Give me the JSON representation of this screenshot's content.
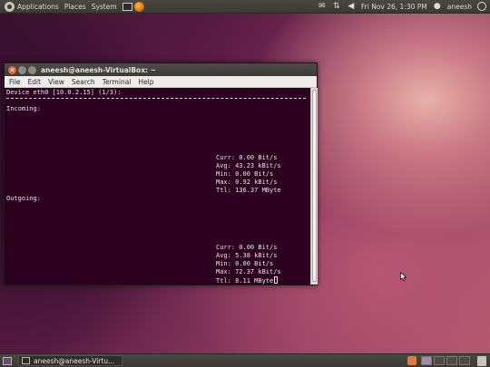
{
  "top_panel": {
    "menus": [
      "Applications",
      "Places",
      "System"
    ],
    "datetime": "Fri Nov 26,  1:30 PM",
    "user": "aneesh"
  },
  "terminal": {
    "title": "aneesh@aneesh-VirtualBox: ~",
    "menu": [
      "File",
      "Edit",
      "View",
      "Search",
      "Terminal",
      "Help"
    ],
    "header": "Device eth0 [10.0.2.15] (1/3):",
    "incoming": {
      "label": "Incoming:",
      "curr": "Curr: 0.00 Bit/s",
      "avg": "Avg: 43.23 kBit/s",
      "min": "Min: 0.00 Bit/s",
      "max": "Max: 0.92 kBit/s",
      "ttl": "Ttl: 136.37 MByte"
    },
    "outgoing": {
      "label": "Outgoing:",
      "curr": "Curr: 0.00 Bit/s",
      "avg": "Avg: 5.38 kBit/s",
      "min": "Min: 0.00 Bit/s",
      "max": "Max: 72.37 kBit/s",
      "ttl": "Ttl: 8.11 MByte"
    }
  },
  "bottom_panel": {
    "task": "aneesh@aneesh-Virtu..."
  },
  "icons": {
    "ubuntu": "ubuntu-logo-icon",
    "terminal": "terminal-icon",
    "firefox": "firefox-icon",
    "mail": "mail-icon",
    "network": "network-icon",
    "volume": "volume-icon",
    "power": "power-icon"
  }
}
